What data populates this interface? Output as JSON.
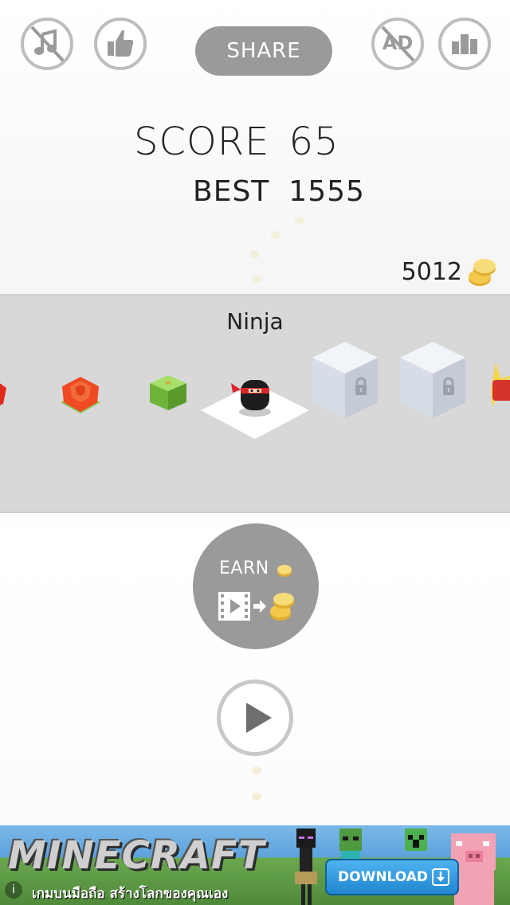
{
  "top_bar": {
    "share_label": "SHARE",
    "ad_label": "AD",
    "buttons": {
      "sound": "music-off-icon",
      "like": "thumbs-up-icon",
      "no_ads": "ad-off-icon",
      "leaderboard": "bar-chart-icon"
    }
  },
  "scores": {
    "score_label": "SCORE",
    "score_value": "65",
    "best_label": "BEST",
    "best_value": "1555"
  },
  "wallet": {
    "coins": "5012",
    "icon": "coin-stack-icon"
  },
  "character_selector": {
    "selected_name": "Ninja",
    "items": [
      {
        "name": "red-partial",
        "locked": false
      },
      {
        "name": "rose",
        "locked": false
      },
      {
        "name": "green-cube",
        "locked": false
      },
      {
        "name": "ninja",
        "locked": false,
        "selected": true
      },
      {
        "name": "locked-1",
        "locked": true
      },
      {
        "name": "locked-2",
        "locked": true
      },
      {
        "name": "red-star-partial",
        "locked": false
      }
    ]
  },
  "earn": {
    "label": "EARN",
    "icon": "video-to-coins-icon"
  },
  "play": {
    "icon": "play-icon"
  },
  "ad_banner": {
    "title": "MINECRAFT",
    "subtitle": "เกมบนมือถือ สร้างโลกของคุณเอง",
    "cta": "DOWNLOAD",
    "info": "i"
  },
  "colors": {
    "button_gray": "#9a9a9a",
    "outline_gray": "#bdbdbd",
    "selector_bg": "#d8d8d8",
    "coin_gold": "#f2c94c"
  }
}
